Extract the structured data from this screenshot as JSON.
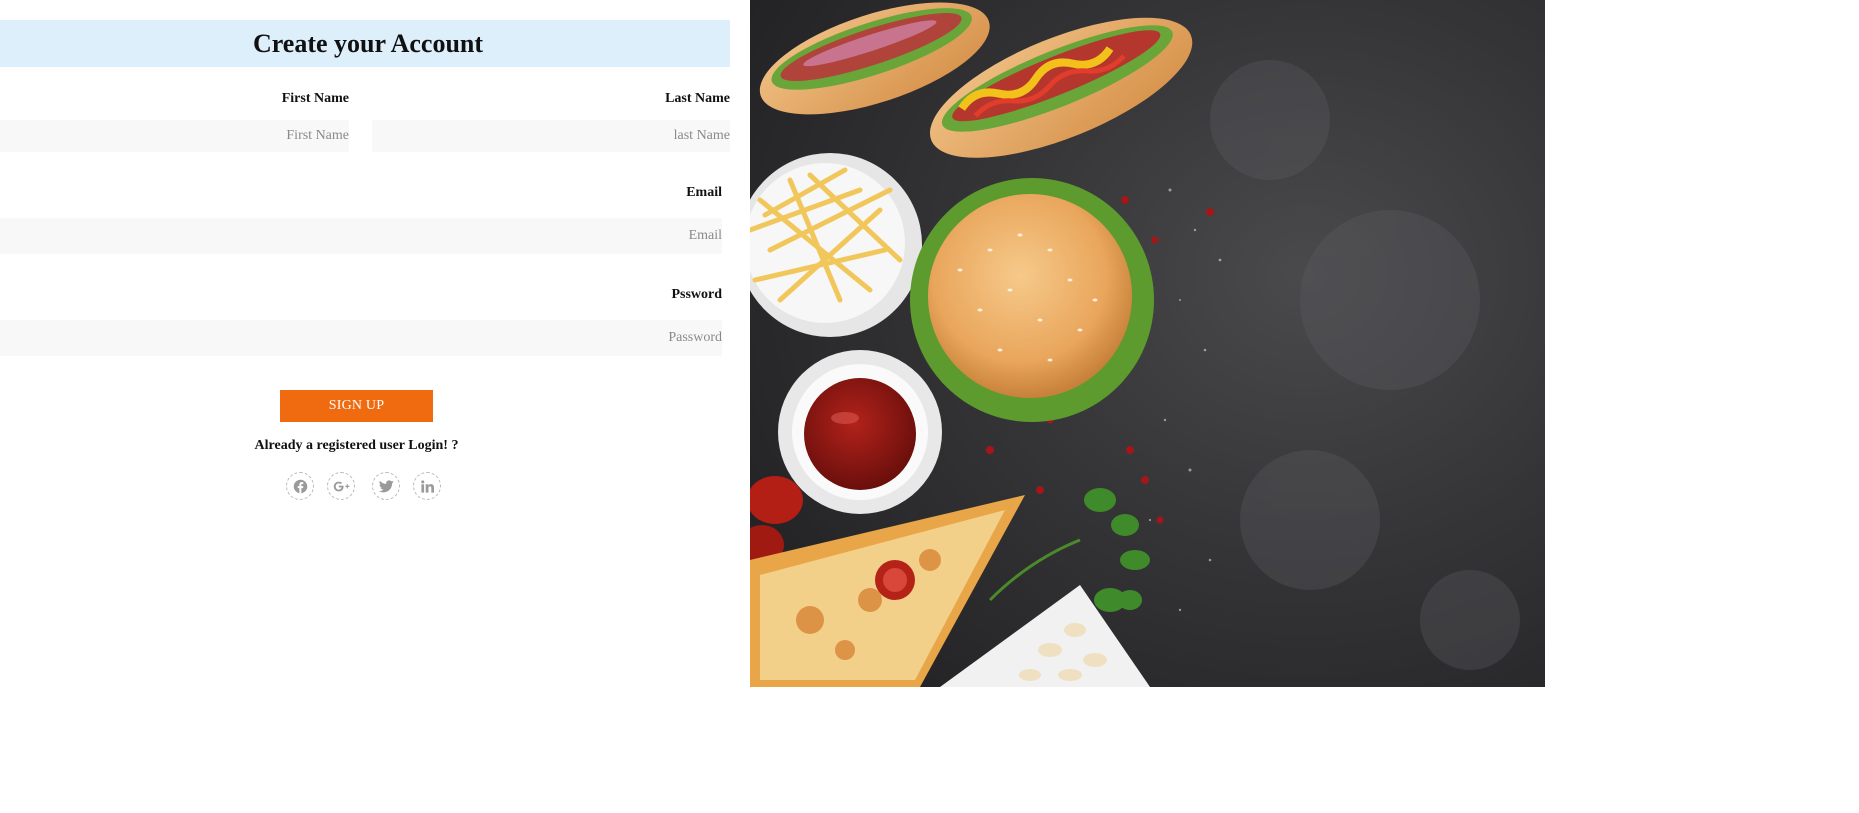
{
  "form": {
    "title": "Create your Account",
    "first_name": {
      "label": "First Name",
      "placeholder": "First Name"
    },
    "last_name": {
      "label": "Last Name",
      "placeholder": "last Name"
    },
    "email": {
      "label": "Email",
      "placeholder": "Email"
    },
    "password": {
      "label": "Pssword",
      "placeholder": "Password"
    },
    "submit_label": "SIGN UP",
    "login_prompt": "Already a registered user Login! ?",
    "socials": [
      "facebook-icon",
      "google-plus-icon",
      "twitter-icon",
      "linkedin-icon"
    ]
  },
  "colors": {
    "title_bar_bg": "#ddeffb",
    "button_bg": "#f06a10",
    "input_bg": "#f8f8f8"
  }
}
